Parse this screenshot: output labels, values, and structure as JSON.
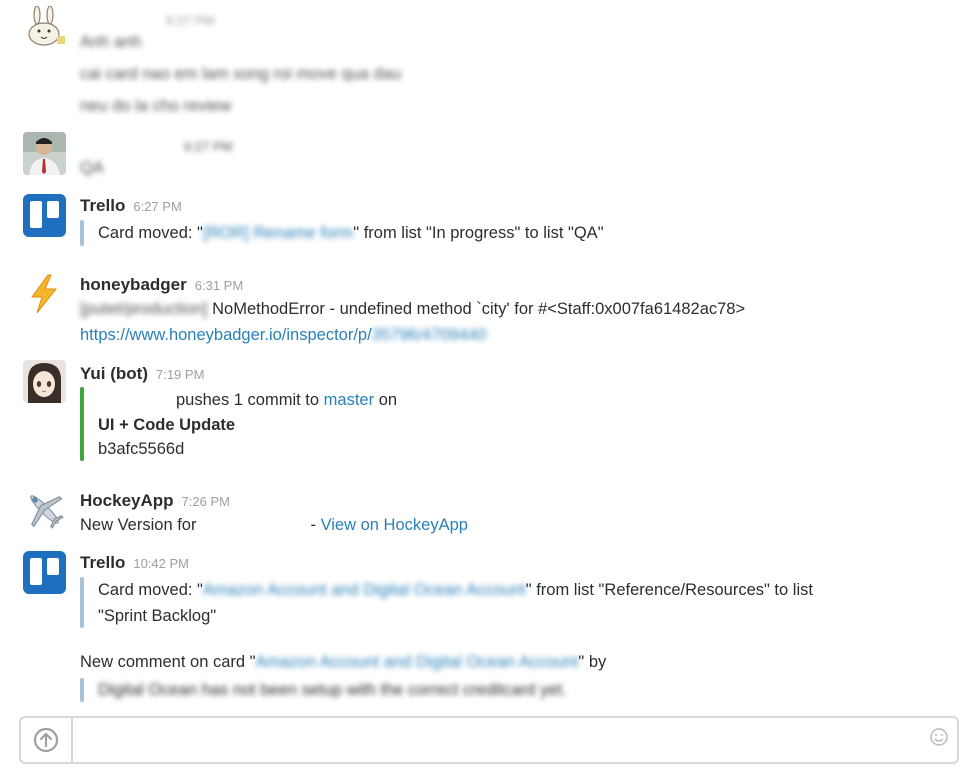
{
  "messages": [
    {
      "id": "m1",
      "sender": "",
      "time": "6:27 PM",
      "lines": [
        "Anh anh",
        "cai card nao em lam xong roi move qua dau",
        "neu do la cho review"
      ]
    },
    {
      "id": "m2",
      "sender": "",
      "time": "6:27 PM",
      "lines": [
        "QA"
      ]
    },
    {
      "id": "m3",
      "sender": "Trello",
      "time": "6:27 PM",
      "attachment": {
        "prefix": "Card moved: \"",
        "card": "[ROR] Rename form",
        "suffix": "\" from list \"In progress\" to list \"QA\""
      }
    },
    {
      "id": "m4",
      "sender": "honeybadger",
      "time": "6:31 PM",
      "tag": "[putet/production]",
      "error": "NoMethodError - undefined method `city' for #<Staff:0x007fa61482ac78>",
      "link_visible": "https://www.honeybadger.io/inspector/p/",
      "link_blurred": "35796/4709440"
    },
    {
      "id": "m5",
      "sender": "Yui (bot)",
      "time": "7:19 PM",
      "commit_text": "pushes 1 commit to",
      "branch": "master",
      "on": "on",
      "title": "UI + Code Update",
      "hash": "b3afc5566d"
    },
    {
      "id": "m6",
      "sender": "HockeyApp",
      "time": "7:26 PM",
      "text": "New Version for",
      "dash": "-",
      "link": "View on HockeyApp"
    },
    {
      "id": "m7",
      "sender": "Trello",
      "time": "10:42 PM",
      "attachment": {
        "prefix": "Card moved: \"",
        "card": "Amazon Account and Digital Ocean Account",
        "suffix": "\" from list \"Reference/Resources\" to list",
        "line2": "\"Sprint Backlog\""
      },
      "comment": {
        "prefix": "New comment on card \"",
        "card": "Amazon Account and Digital Ocean Account",
        "suffix": "\" by",
        "quote": "Digital Ocean has not been setup with the correct creditcard yet."
      }
    }
  ],
  "composer": {
    "placeholder": ""
  },
  "colors": {
    "link": "#2a80b9",
    "trello_bar": "#a8c1d6",
    "github_bar": "#3ea63e",
    "trello_logo": "#1f6fbf"
  },
  "icons": [
    "rabbit-avatar",
    "person-avatar",
    "trello-icon",
    "lightning-icon",
    "anime-avatar",
    "airplane-icon",
    "upload-icon",
    "emoji-icon"
  ]
}
